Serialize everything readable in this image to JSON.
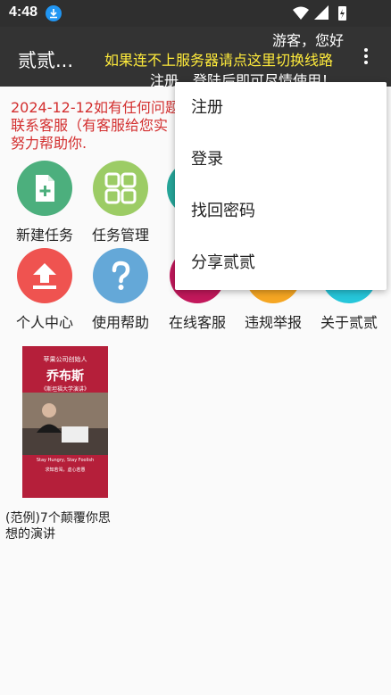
{
  "status_bar": {
    "time": "4:48"
  },
  "app_bar": {
    "title": "贰贰...",
    "guest_greeting": "游客，您好",
    "switch_line_hint": "如果连不上服务器请点这里切换线路",
    "register_hint": "注册、登陆后即可尽情使用！"
  },
  "notice": {
    "line1": "2024-12-12如有任何问题",
    "line2": "联系客服（有客服给您实",
    "line3": "努力帮助你."
  },
  "grid": [
    {
      "label": "新建任务",
      "color": "#4caf7d",
      "icon": "new-file-icon"
    },
    {
      "label": "任务管理",
      "color": "#9ccc65",
      "icon": "grid-icon"
    },
    {
      "label": "",
      "color": "#26a69a",
      "icon": ""
    },
    {
      "label": "",
      "color": "#f9a825",
      "icon": ""
    },
    {
      "label": "",
      "color": "#29b6f6",
      "icon": ""
    },
    {
      "label": "个人中心",
      "color": "#ef5350",
      "icon": "upload-icon"
    },
    {
      "label": "使用帮助",
      "color": "#64a8d8",
      "icon": "question-icon"
    },
    {
      "label": "在线客服",
      "color": "#c2185b",
      "icon": ""
    },
    {
      "label": "违规举报",
      "color": "#f5a623",
      "icon": ""
    },
    {
      "label": "关于贰贰",
      "color": "#26c6da",
      "icon": ""
    }
  ],
  "example": {
    "cover_top": "苹果公司创始人",
    "cover_name": "乔布斯",
    "cover_sub": "《斯坦福大学演讲》",
    "cover_bottom1": "Stay Hungry, Stay Foolish",
    "cover_bottom2": "求知若渴，虚心若愚",
    "title": "(范例)7个颠覆你思想的演讲"
  },
  "menu": {
    "items": [
      "注册",
      "登录",
      "找回密码",
      "分享贰贰"
    ]
  },
  "colors": {
    "status_bar": "#2f2f2f",
    "app_bar": "#333333",
    "notice": "#d32f2f",
    "switch_line": "#ffeb3b"
  }
}
